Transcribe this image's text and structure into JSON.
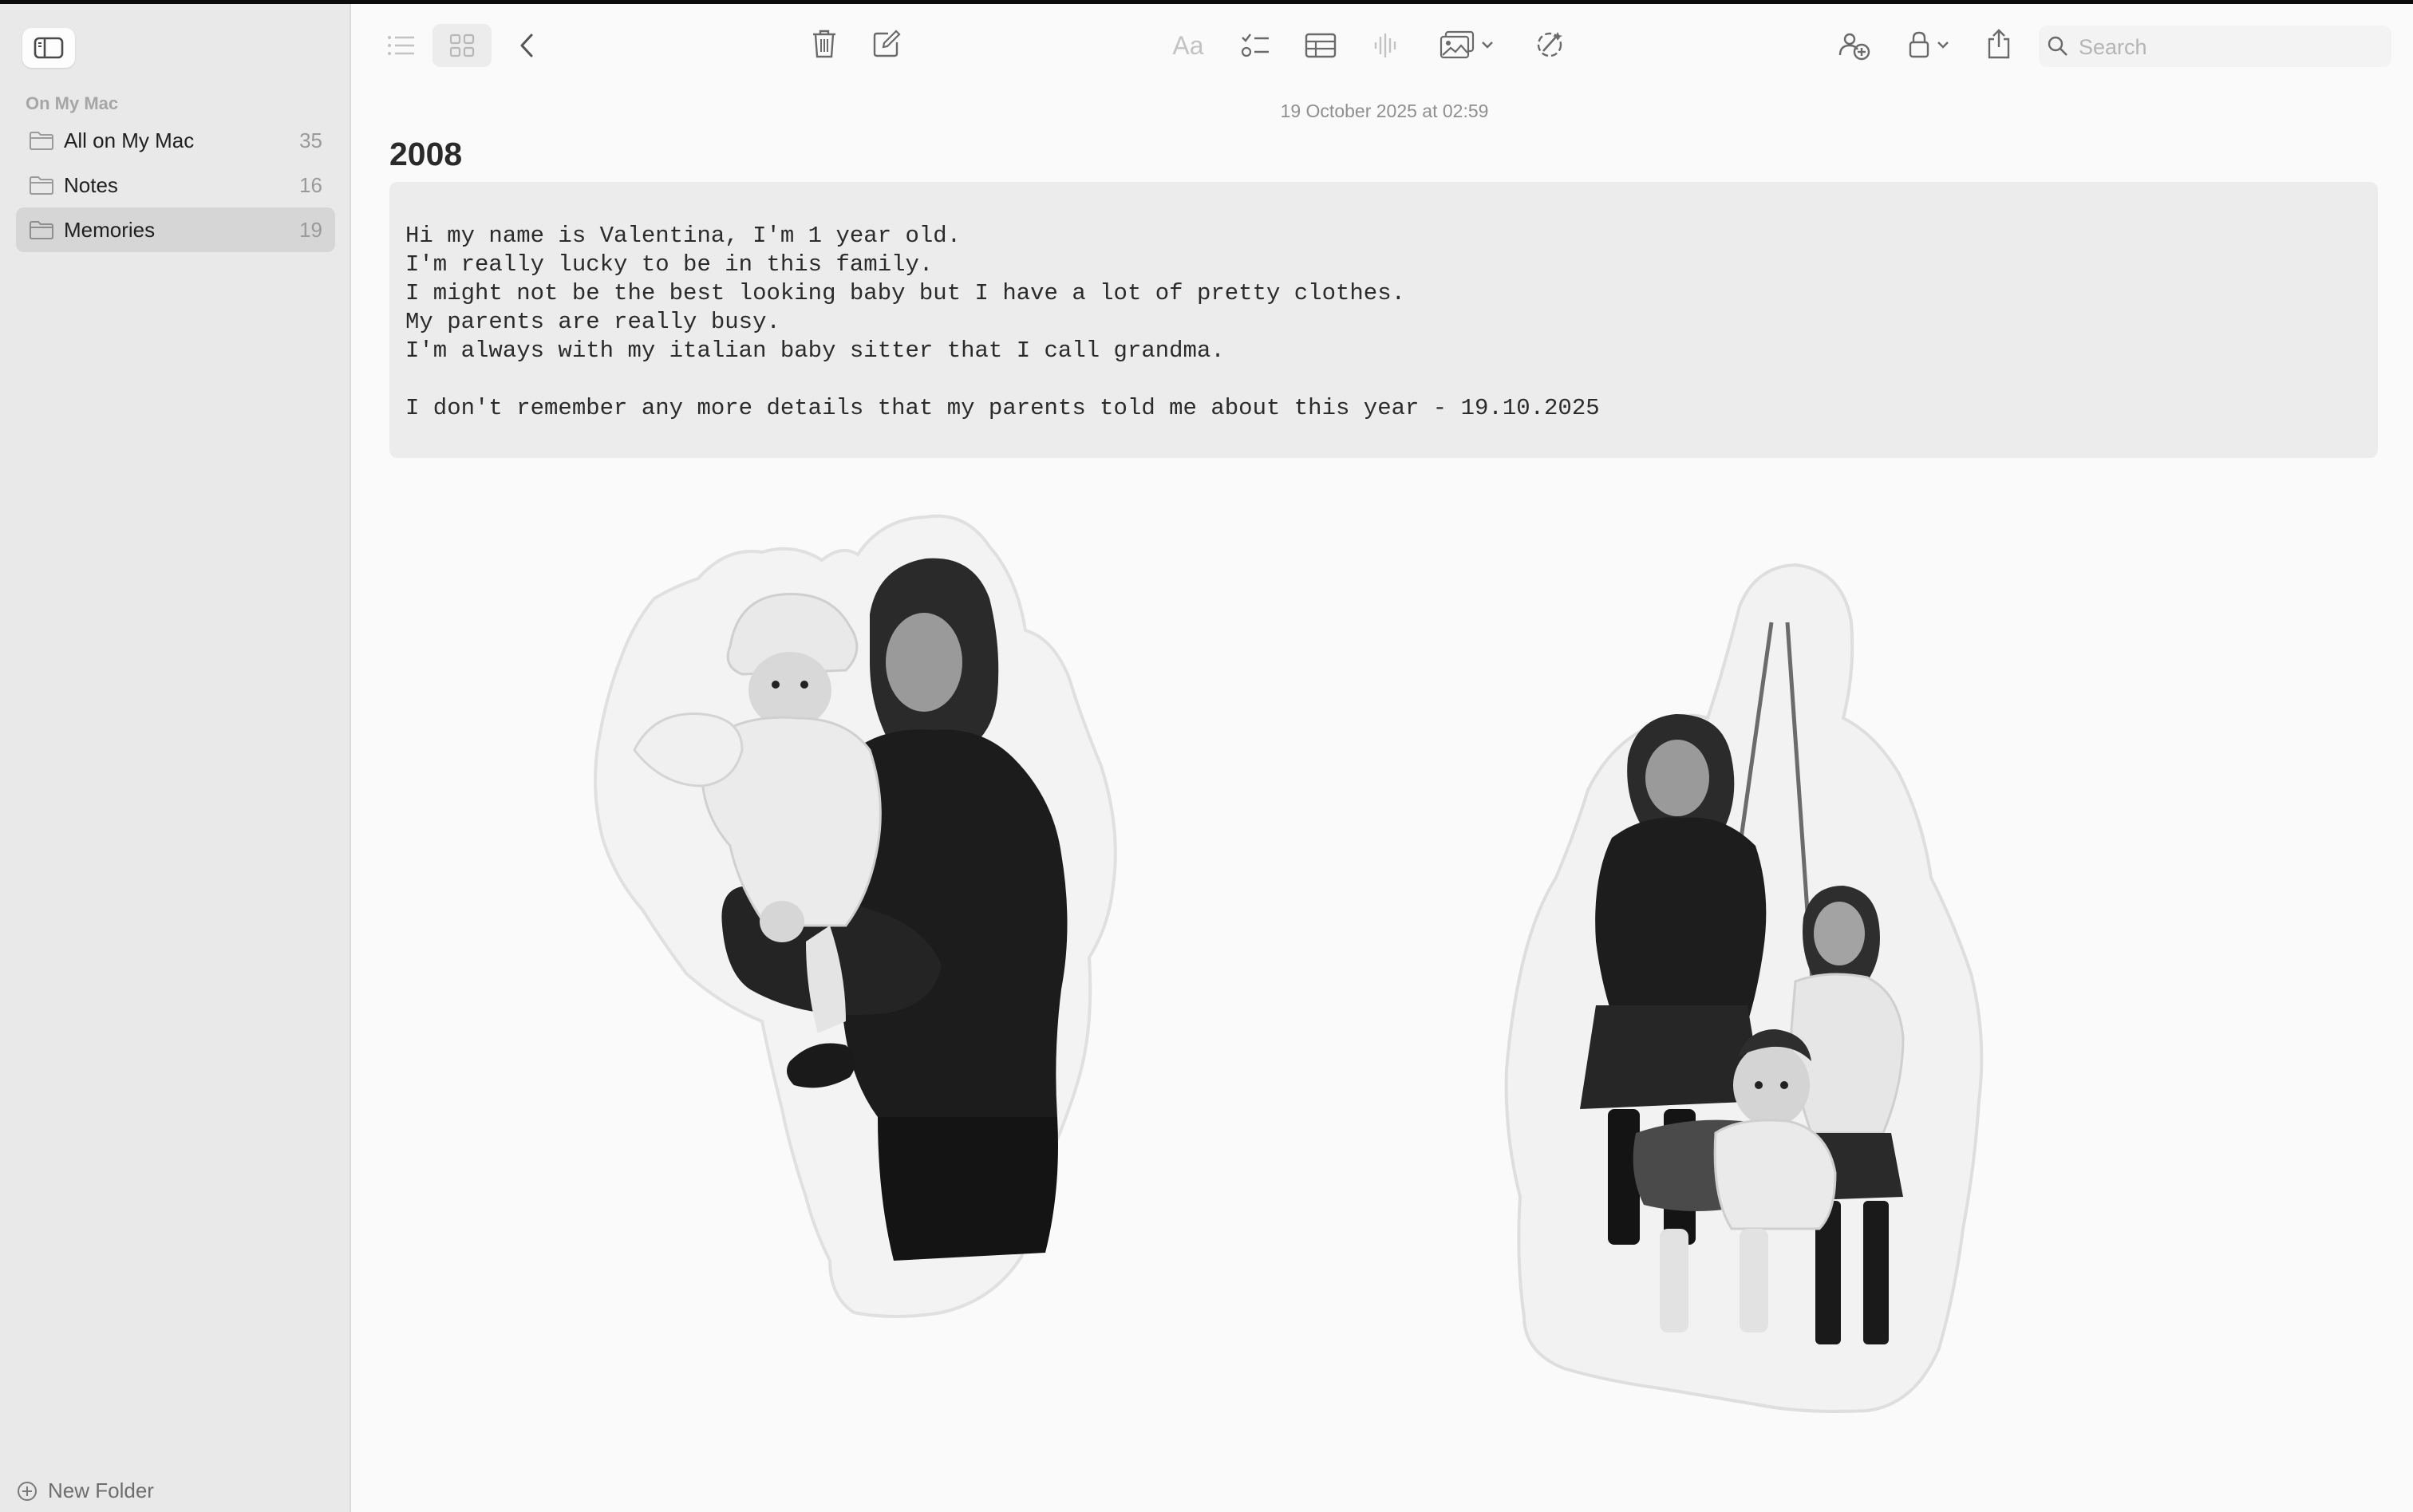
{
  "sidebar": {
    "section_title": "On My Mac",
    "folders": [
      {
        "label": "All on My Mac",
        "count": "35",
        "selected": false
      },
      {
        "label": "Notes",
        "count": "16",
        "selected": false
      },
      {
        "label": "Memories",
        "count": "19",
        "selected": true
      }
    ],
    "new_folder_label": "New Folder"
  },
  "toolbar": {
    "format_label": "Aa",
    "search_placeholder": "Search"
  },
  "note": {
    "date": "19 October 2025 at 02:59",
    "title": "2008",
    "lines": [
      "Hi my name is Valentina, I'm 1 year old.",
      "I'm really lucky to be in this family.",
      "I might not be the best looking baby but I have a lot of pretty clothes.",
      "My parents are really busy.",
      "I'm always with my italian baby sitter that I call grandma.",
      "",
      "I don't remember any more details that my parents told me about this year - 19.10.2025"
    ]
  },
  "icons": {
    "sidebar_toggle": "sidebar-toggle-icon",
    "list_view": "list-view-icon",
    "gallery_view": "gallery-view-icon",
    "back": "chevron-left-icon",
    "delete": "trash-icon",
    "compose": "compose-icon",
    "checklist": "checklist-icon",
    "table": "table-icon",
    "audio": "waveform-icon",
    "media": "photo-icon",
    "collaborate": "collaborate-icon",
    "lock": "lock-icon",
    "share": "share-icon",
    "search": "search-icon"
  }
}
